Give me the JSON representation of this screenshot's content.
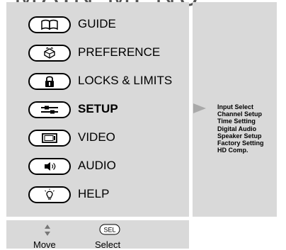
{
  "title": "MAIN MENU",
  "menu_items": [
    {
      "label": "GUIDE",
      "icon": "book-icon",
      "selected": false
    },
    {
      "label": "PREFERENCE",
      "icon": "preference-icon",
      "selected": false
    },
    {
      "label": "LOCKS & LIMITS",
      "icon": "lock-icon",
      "selected": false
    },
    {
      "label": "SETUP",
      "icon": "setup-tools-icon",
      "selected": true
    },
    {
      "label": "VIDEO",
      "icon": "tv-screen-icon",
      "selected": false
    },
    {
      "label": "AUDIO",
      "icon": "speaker-icon",
      "selected": false
    },
    {
      "label": "HELP",
      "icon": "lightbulb-icon",
      "selected": false
    }
  ],
  "submenu": {
    "items": [
      "Input Select",
      "Channel Setup",
      "Time Setting",
      "Digital Audio",
      "Speaker Setup",
      "Factory Setting",
      "HD Comp."
    ]
  },
  "legend": {
    "move_label": "Move",
    "select_label": "Select",
    "sel_badge": "SEL"
  },
  "colors": {
    "panel": "#d9d9d9",
    "title": "#555555",
    "arrow": "#a9a9a9"
  }
}
